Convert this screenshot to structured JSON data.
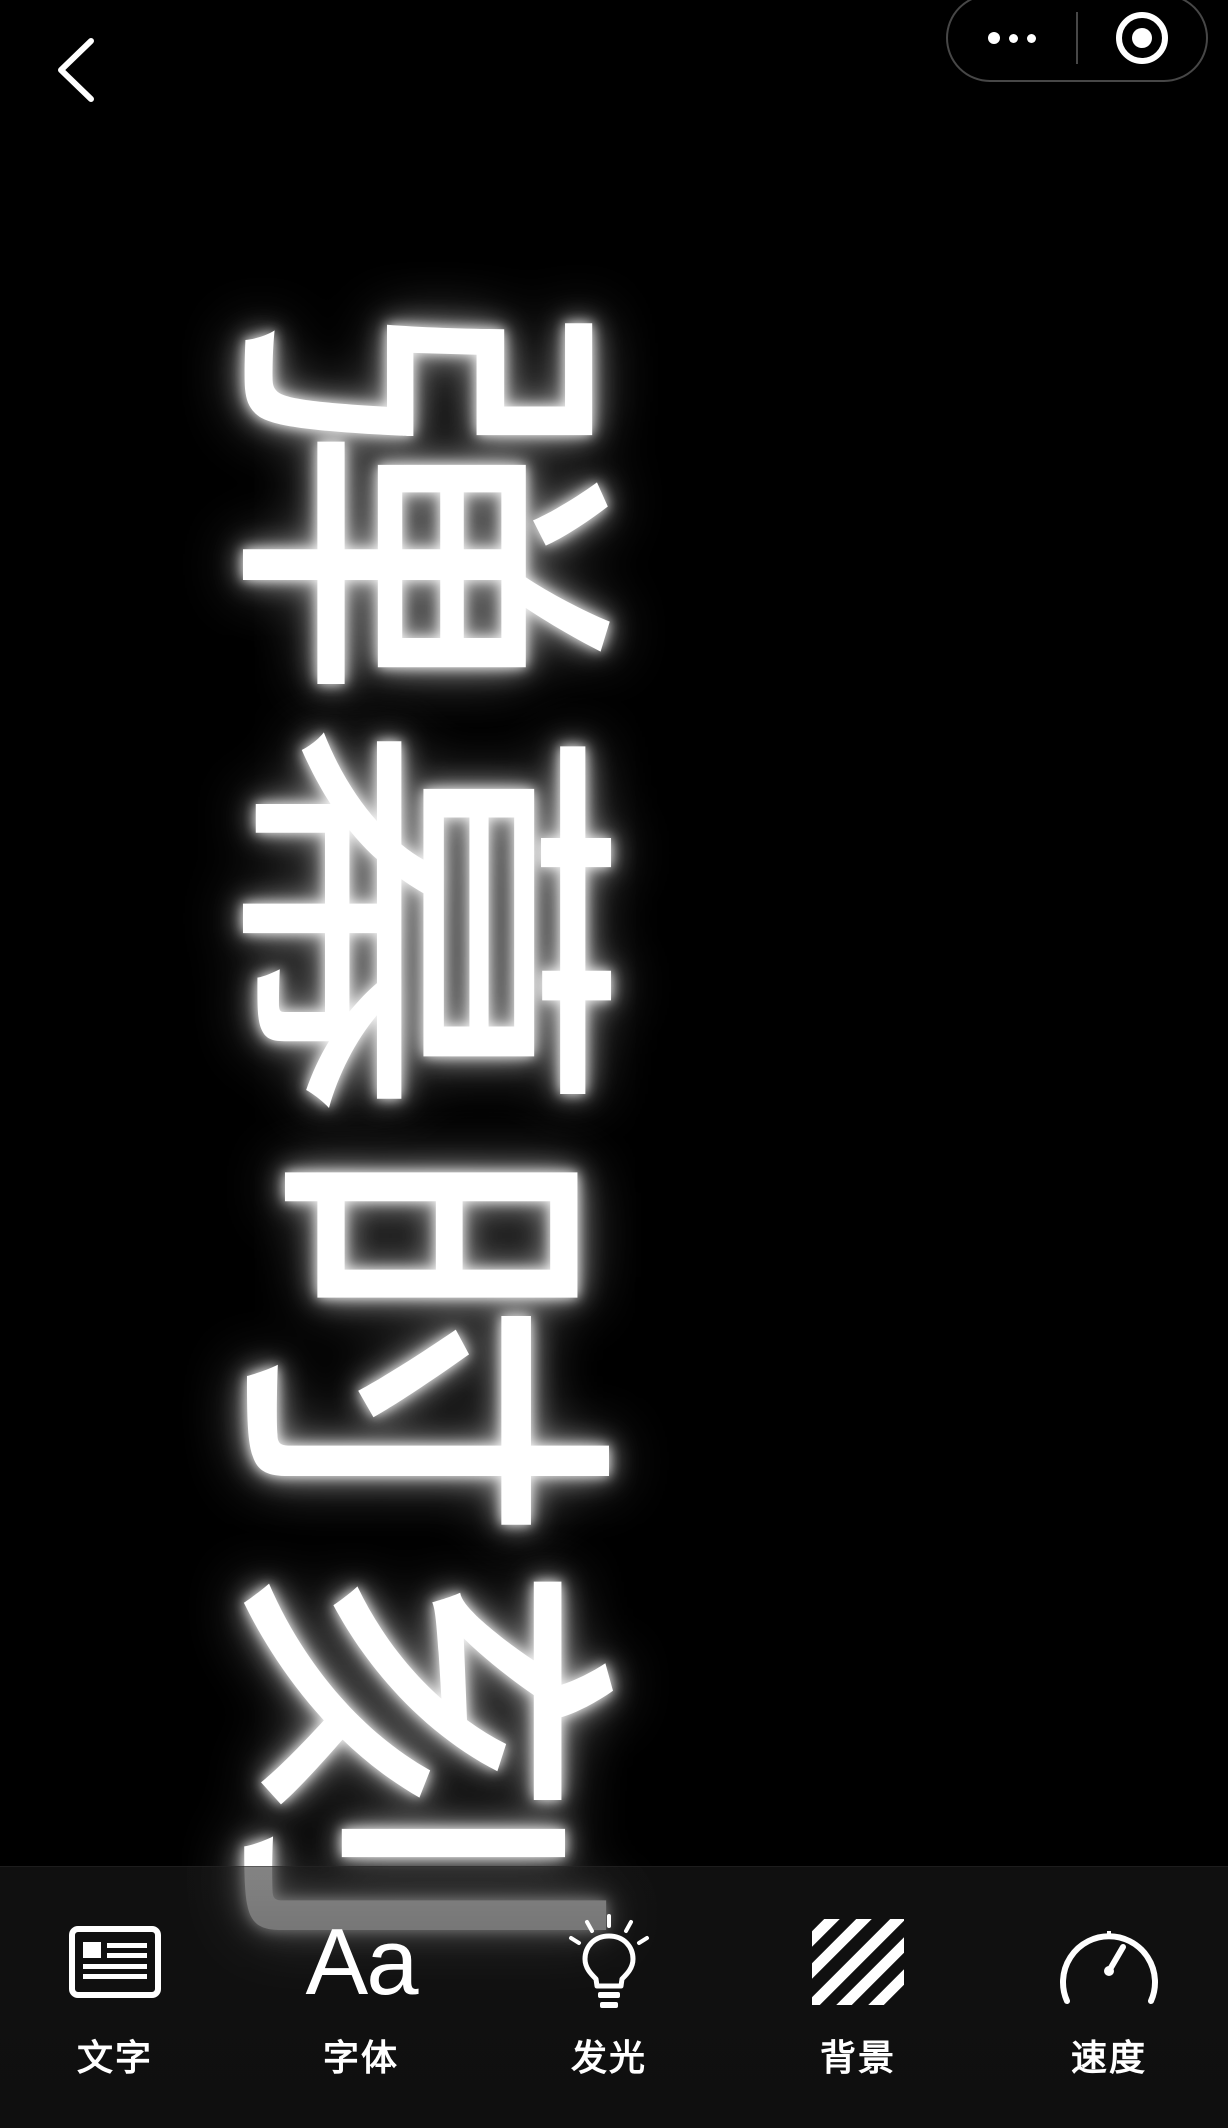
{
  "nav": {
    "back_icon": "chevron-left-icon",
    "more_icon": "more-dots-icon",
    "close_icon": "target-circle-icon"
  },
  "marquee": {
    "text": "弹幕时刻",
    "orientation": "rotated-90",
    "color": "#FFFFFF",
    "glow": true
  },
  "toolbar": {
    "items": [
      {
        "label": "文字",
        "icon": "text-card-icon"
      },
      {
        "label": "字体",
        "icon": "font-aa-icon",
        "glyph": "Aa"
      },
      {
        "label": "发光",
        "icon": "lightbulb-icon"
      },
      {
        "label": "背景",
        "icon": "stripes-background-icon"
      },
      {
        "label": "速度",
        "icon": "speedometer-icon"
      }
    ]
  },
  "colors": {
    "background": "#000000",
    "foreground": "#FFFFFF"
  }
}
